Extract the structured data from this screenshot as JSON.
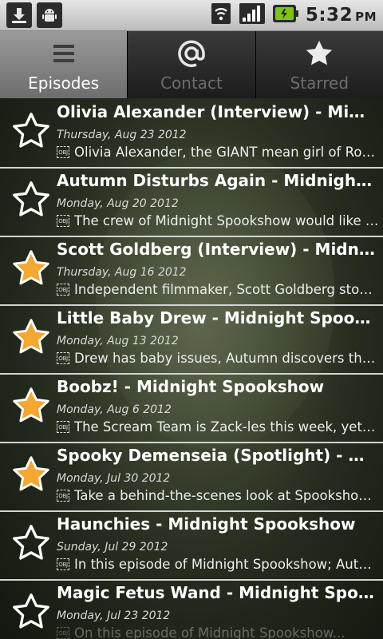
{
  "status_bar": {
    "time": "5:32",
    "ampm": "PM",
    "left_icons": [
      "download-icon",
      "android-icon"
    ],
    "right_icons": [
      "wifi-icon",
      "signal-icon",
      "battery-icon"
    ],
    "battery_color": "#7ec21b"
  },
  "tabs": [
    {
      "label": "Episodes",
      "icon": "list-icon",
      "active": true
    },
    {
      "label": "Contact",
      "icon": "at-sign-icon",
      "active": false
    },
    {
      "label": "Starred",
      "icon": "star-icon",
      "active": false
    }
  ],
  "episodes": [
    {
      "title": "Olivia Alexander (Interview) - Midnight Spookshow",
      "date": "Thursday, Aug 23 2012",
      "description": "Olivia Alexander, the GIANT mean girl of Rock Chicks...",
      "starred": false
    },
    {
      "title": "Autumn Disturbs Again - Midnight Spookshow",
      "date": "Monday, Aug 20 2012",
      "description": "The crew of Midnight Spookshow would like to welcome...",
      "starred": false
    },
    {
      "title": "Scott Goldberg (Interview) - Midnight Spookshow",
      "date": "Thursday, Aug 16 2012",
      "description": "Independent filmmaker, Scott Goldberg stops by...",
      "starred": true
    },
    {
      "title": "Little Baby Drew - Midnight Spookshow",
      "date": "Monday, Aug 13 2012",
      "description": "Drew has baby issues, Autumn discovers the...",
      "starred": true
    },
    {
      "title": "Boobz! - Midnight Spookshow",
      "date": "Monday, Aug 6 2012",
      "description": "The Scream Team is Zack-les this week, yet some...",
      "starred": true
    },
    {
      "title": "Spooky Demenseia (Spotlight) - Midnight Spookshow",
      "date": "Monday, Jul 30 2012",
      "description": "Take a behind-the-scenes look at Spookshow...",
      "starred": true
    },
    {
      "title": "Haunchies - Midnight Spookshow",
      "date": "Sunday, Jul 29 2012",
      "description": "In this episode of Midnight Spookshow; Autumn...",
      "starred": false
    },
    {
      "title": "Magic Fetus Wand - Midnight Spookshow",
      "date": "Monday, Jul 23 2012",
      "description": "On this episode of Midnight Spookshow...",
      "starred": false
    }
  ],
  "colors": {
    "star_filled": "#f4a732",
    "star_outline": "#ffffff",
    "divider": "#d4d4d4",
    "active_tab": "#8a8a8a"
  }
}
